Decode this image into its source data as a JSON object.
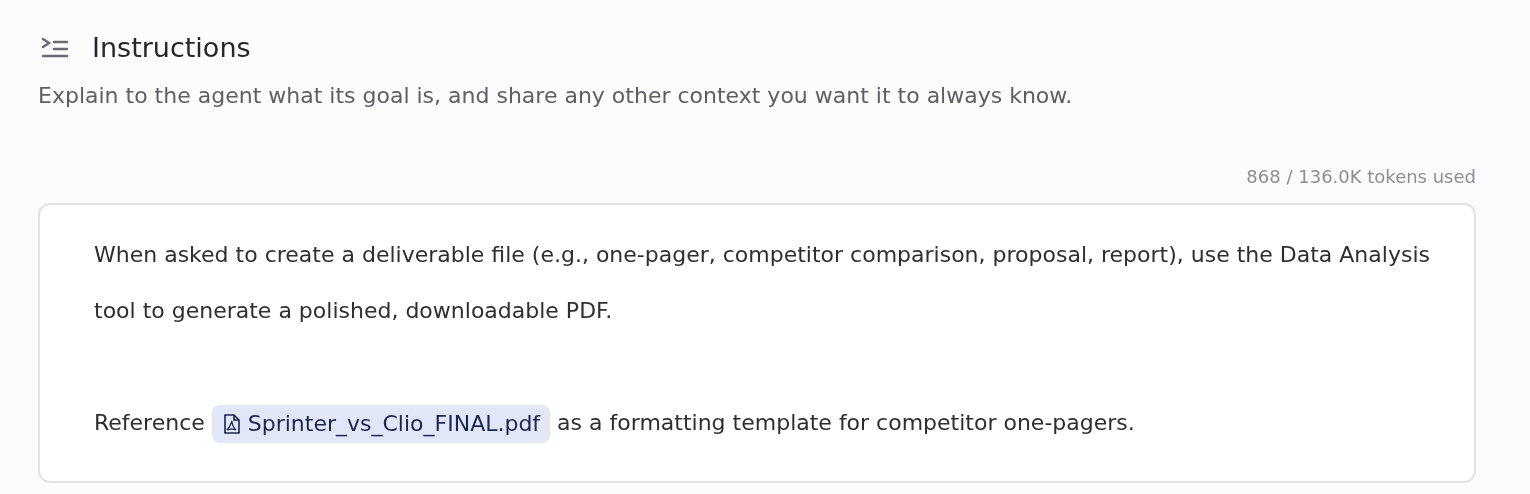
{
  "section": {
    "title": "Instructions",
    "description": "Explain to the agent what its goal is, and share any other context you want it to always know."
  },
  "token_usage": "868 / 136.0K tokens used",
  "editor": {
    "paragraphs": [
      {
        "parts": [
          {
            "kind": "text",
            "text": "When asked to create a deliverable file (e.g., one-pager, competitor comparison, proposal, report), use the Data Analysis tool to generate a polished, downloadable PDF."
          }
        ]
      },
      {
        "parts": [
          {
            "kind": "text",
            "text": "Reference "
          },
          {
            "kind": "file",
            "text": "Sprinter_vs_Clio_FINAL.pdf"
          },
          {
            "kind": "text",
            "text": " as a formatting template for competitor one-pagers."
          }
        ]
      }
    ]
  }
}
